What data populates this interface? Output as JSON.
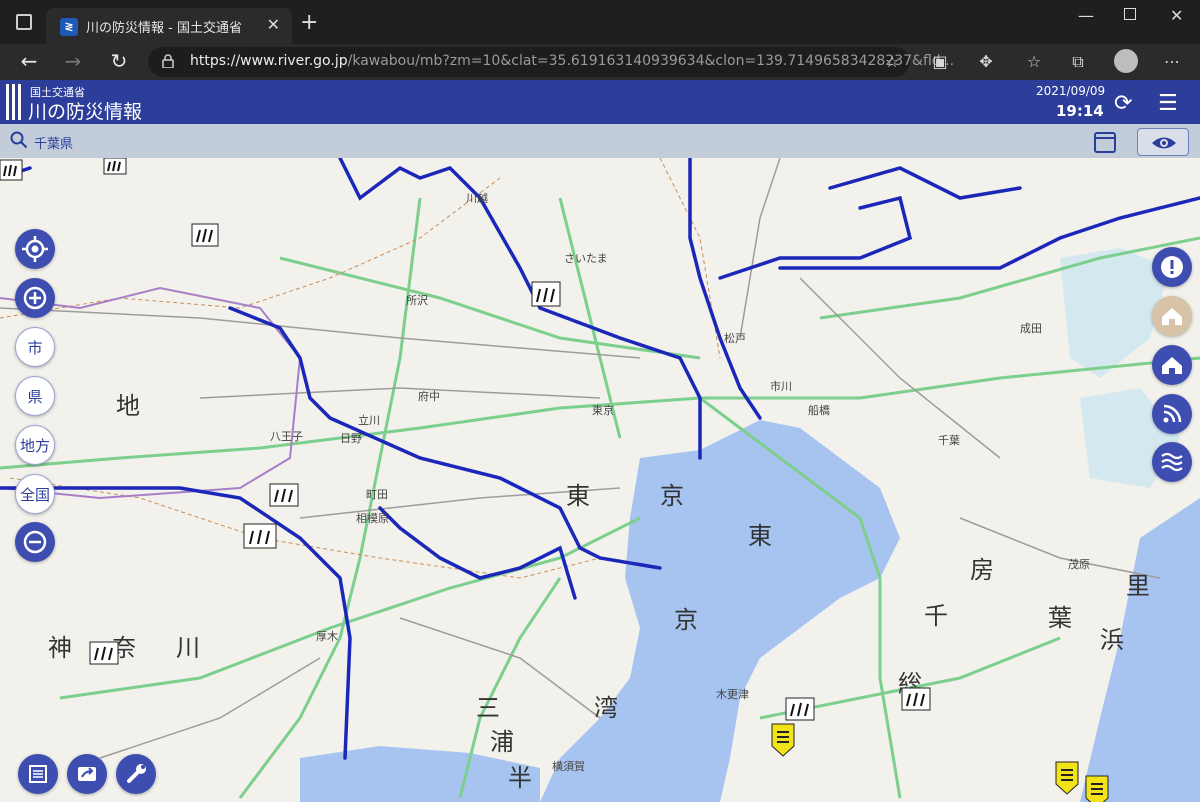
{
  "browser": {
    "tab_title": "川の防災情報 - 国土交通省",
    "url_domain": "https://www.river.go.jp",
    "url_rest": "/kawabou/mb?zm=10&clat=35.619163140939634&clon=139.71496583428237&fld...",
    "icons": [
      "tab-actions-icon",
      "close-icon",
      "new-tab-icon",
      "minimize-icon",
      "maximize-icon",
      "close-window-icon",
      "back-icon",
      "forward-icon",
      "refresh-icon",
      "lock-icon",
      "add-favorite-icon",
      "extension-icon",
      "puzzle-icon",
      "favorites-icon",
      "collections-icon",
      "profile-icon",
      "more-icon"
    ]
  },
  "app": {
    "ministry": "国土交通省",
    "title": "川の防災情報",
    "date": "2021/09/09",
    "time": "19:14",
    "search_text": "千葉県"
  },
  "map_controls": {
    "left": [
      "市",
      "県",
      "地方",
      "全国"
    ],
    "bottom": [
      "list-icon",
      "share-icon",
      "wrench-icon"
    ],
    "right": [
      "alert-icon",
      "home-icon",
      "home-icon",
      "rss-icon",
      "waves-icon"
    ]
  },
  "map_labels": {
    "places": [
      {
        "t": "東",
        "k": "bay"
      },
      {
        "t": "京",
        "k": "bay"
      },
      {
        "t": "湾",
        "k": "bay"
      },
      {
        "t": "東",
        "k": "land"
      },
      {
        "t": "京",
        "k": "land"
      },
      {
        "t": "神",
        "k": "land"
      },
      {
        "t": "奈",
        "k": "land"
      },
      {
        "t": "川",
        "k": "land"
      },
      {
        "t": "千",
        "k": "land"
      },
      {
        "t": "葉",
        "k": "land"
      },
      {
        "t": "房",
        "k": "land"
      },
      {
        "t": "総",
        "k": "land"
      },
      {
        "t": "三",
        "k": "land"
      },
      {
        "t": "浦",
        "k": "land"
      },
      {
        "t": "半",
        "k": "land"
      },
      {
        "t": "里",
        "k": "land"
      },
      {
        "t": "浜",
        "k": "land"
      },
      {
        "t": "地",
        "k": "land"
      }
    ],
    "cities": [
      "所沢",
      "府中",
      "町田",
      "相模原",
      "東京",
      "市川",
      "千葉",
      "木更津",
      "横須賀",
      "厚木",
      "川越",
      "さいたま",
      "松戸",
      "船橋",
      "成田",
      "茂原",
      "八王子",
      "日野",
      "立川"
    ]
  },
  "colors": {
    "header_blue": "#2c3e9a",
    "river_blue": "#1a27b8",
    "sea_blue": "#a7c4f1",
    "warning_yellow": "#f2e21a"
  }
}
